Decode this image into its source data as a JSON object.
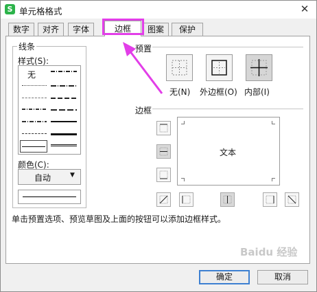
{
  "window": {
    "title": "单元格格式",
    "close_glyph": "✕"
  },
  "tabs": [
    "数字",
    "对齐",
    "字体",
    "边框",
    "图案",
    "保护"
  ],
  "active_tab": "边框",
  "line_group": {
    "legend": "线条",
    "style_label": "样式(S):",
    "style_none": "无",
    "color_label": "颜色(C):",
    "color_value": "自动",
    "color_swatch": "#000000"
  },
  "presets": {
    "legend": "预置",
    "items": [
      {
        "label": "无(N)",
        "icon": "no-border-icon"
      },
      {
        "label": "外边框(O)",
        "icon": "outline-border-icon"
      },
      {
        "label": "内部(I)",
        "icon": "inside-border-icon"
      }
    ]
  },
  "border": {
    "legend": "边框",
    "preview_text": "文本"
  },
  "hint": "单击预置选项、预览草图及上面的按钮可以添加边框样式。",
  "buttons": {
    "ok": "确定",
    "cancel": "取消"
  },
  "annotation": {
    "highlight_color": "#e23ee8"
  },
  "watermark": "Baidu 经验"
}
